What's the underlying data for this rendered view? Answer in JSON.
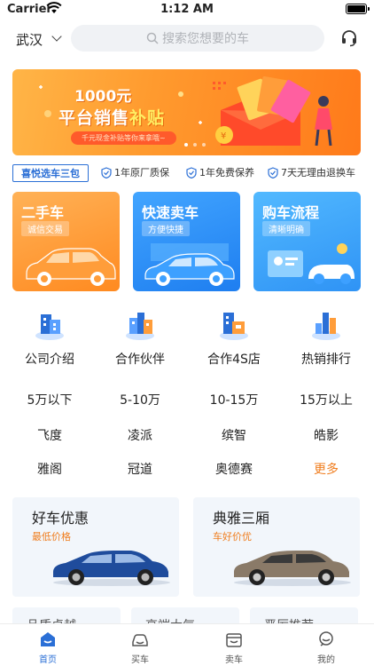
{
  "status_bar": {
    "carrier": "Carrier",
    "time": "1:12 AM"
  },
  "header": {
    "city": "武汉",
    "search_placeholder": "搜索您想要的车"
  },
  "banner": {
    "amount": "1000元",
    "title_main": "平台销售",
    "title_highlight": "补贴",
    "subtitle": "千元现金补贴等你来拿哦~",
    "accent_color": "#ff8a20"
  },
  "guarantees": {
    "badge": "喜悦选车三包",
    "items": [
      "1年原厂质保",
      "1年免费保养",
      "7天无理由退换车"
    ]
  },
  "services": [
    {
      "title": "二手车",
      "tag": "诚信交易"
    },
    {
      "title": "快速卖车",
      "tag": "方便快捷"
    },
    {
      "title": "购车流程",
      "tag": "清晰明确"
    }
  ],
  "icon_items": [
    {
      "label": "公司介绍",
      "icon": "building-icon"
    },
    {
      "label": "合作伙伴",
      "icon": "partner-building-icon"
    },
    {
      "label": "合作4S店",
      "icon": "dealer-store-icon"
    },
    {
      "label": "热销排行",
      "icon": "ranking-chart-icon"
    }
  ],
  "price_ranges": [
    "5万以下",
    "5-10万",
    "10-15万",
    "15万以上"
  ],
  "models_row1": [
    "飞度",
    "凌派",
    "缤智",
    "皓影"
  ],
  "models_row2": [
    "雅阁",
    "冠道",
    "奥德赛",
    "更多"
  ],
  "promos": [
    {
      "title": "好车优惠",
      "subtitle": "最低价格"
    },
    {
      "title": "典雅三厢",
      "subtitle": "车好价优"
    }
  ],
  "peek_cards": [
    "品质卓越",
    "高端大气",
    "严厉推荐"
  ],
  "tabs": [
    {
      "label": "首页",
      "active": true
    },
    {
      "label": "买车",
      "active": false
    },
    {
      "label": "卖车",
      "active": false
    },
    {
      "label": "我的",
      "active": false
    }
  ],
  "colors": {
    "primary": "#2b6fd6",
    "accent": "#f07d1e"
  }
}
